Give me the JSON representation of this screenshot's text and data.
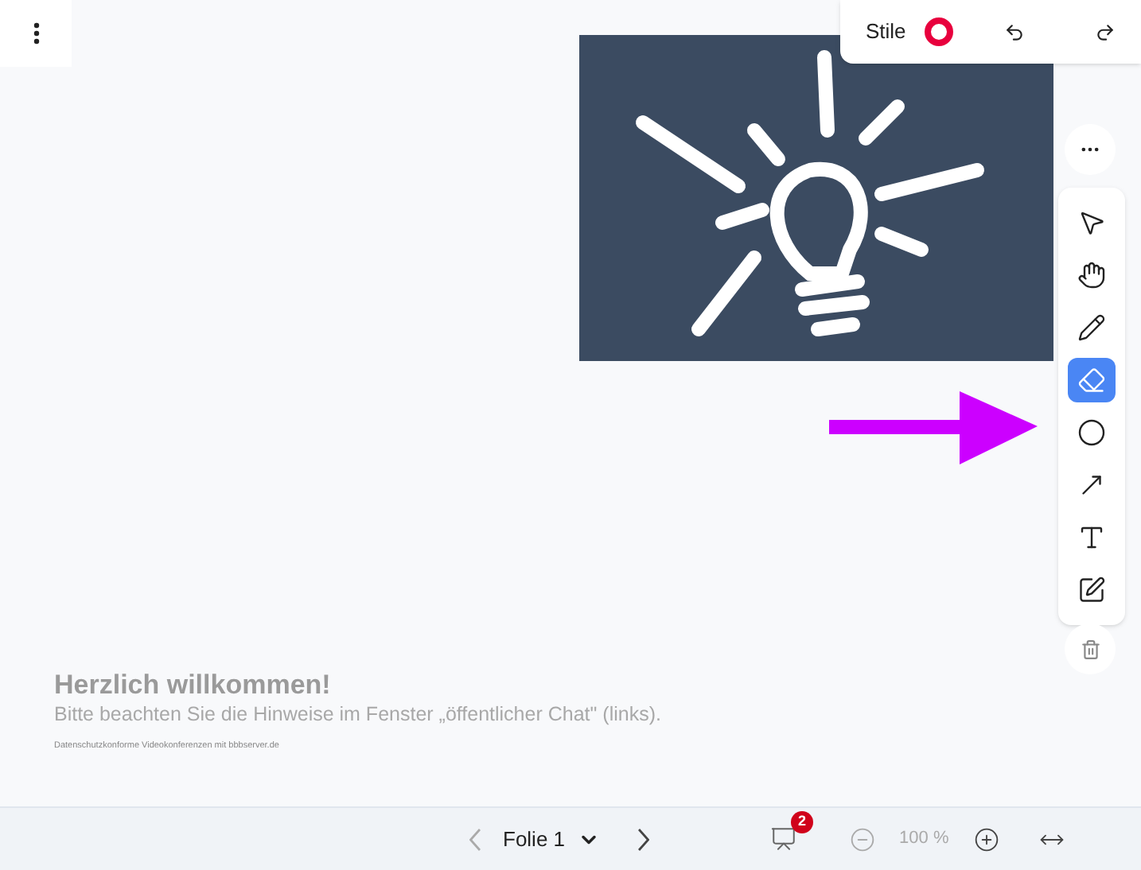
{
  "styles_panel": {
    "label": "Stile",
    "color": "#e8003d"
  },
  "tools": [
    {
      "kind": "select",
      "selected": false
    },
    {
      "kind": "hand",
      "selected": false
    },
    {
      "kind": "pencil",
      "selected": false
    },
    {
      "kind": "eraser",
      "selected": true
    },
    {
      "kind": "ellipse",
      "selected": false
    },
    {
      "kind": "arrow",
      "selected": false
    },
    {
      "kind": "text",
      "selected": false
    },
    {
      "kind": "note",
      "selected": false
    }
  ],
  "slide": {
    "title": "Herzlich willkommen!",
    "subtitle": "Bitte beachten Sie die Hinweise im Fenster „öffentlicher Chat\" (links).",
    "footer": "Datenschutzkonforme Videokonferenzen mit bbbserver.de"
  },
  "bottom_bar": {
    "slide_label": "Folie 1",
    "badge": "2",
    "zoom": "100 %"
  }
}
